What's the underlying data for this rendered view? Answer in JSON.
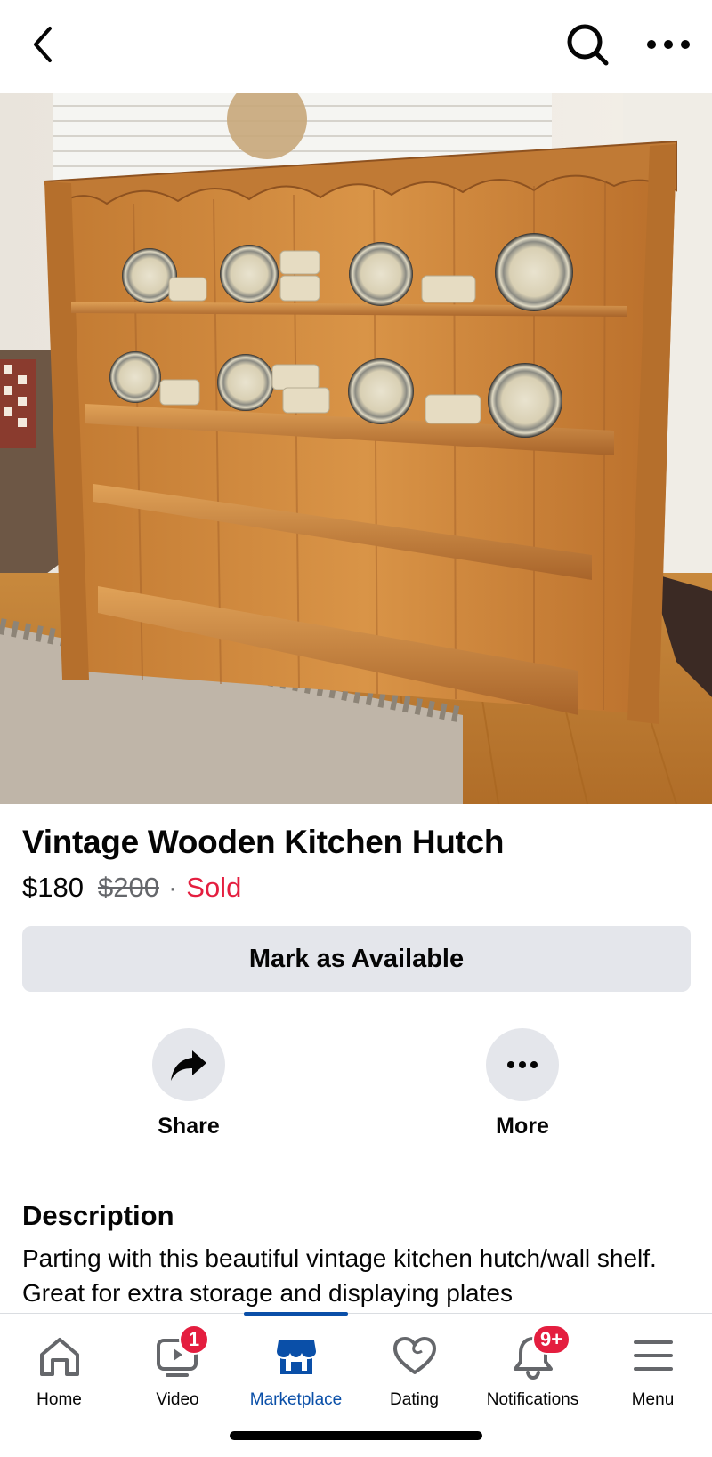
{
  "header": {
    "back_icon": "chevron-left-icon",
    "search_icon": "search-icon",
    "more_icon": "more-horizontal-icon"
  },
  "photo": {
    "description_icon": "listing-photo",
    "page_count": 4,
    "active_index": 0
  },
  "listing": {
    "title": "Vintage Wooden Kitchen Hutch",
    "price": "$180",
    "original_price": "$200",
    "separator": "·",
    "status": "Sold",
    "status_color": "#e41e3f"
  },
  "actions": {
    "mark_available_label": "Mark as Available",
    "share_label": "Share",
    "more_label": "More"
  },
  "description": {
    "heading": "Description",
    "text": "Parting with this beautiful vintage kitchen hutch/wall shelf. Great for extra storage and displaying plates"
  },
  "bottom_nav": {
    "items": [
      {
        "label": "Home",
        "icon": "home-icon",
        "badge": ""
      },
      {
        "label": "Video",
        "icon": "video-icon",
        "badge": "1"
      },
      {
        "label": "Marketplace",
        "icon": "marketplace-icon",
        "badge": "",
        "active": true
      },
      {
        "label": "Dating",
        "icon": "dating-heart-icon",
        "badge": ""
      },
      {
        "label": "Notifications",
        "icon": "bell-icon",
        "badge": "9+"
      },
      {
        "label": "Menu",
        "icon": "menu-icon",
        "badge": ""
      }
    ],
    "active_color": "#0a4fa8"
  }
}
